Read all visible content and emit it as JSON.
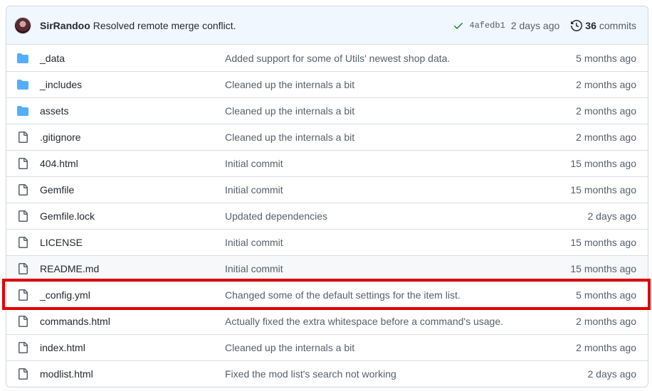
{
  "latest_commit": {
    "author": "SirRandoo",
    "message": "Resolved remote merge conflict.",
    "sha": "4afedb1",
    "age": "2 days ago",
    "commit_count": "36",
    "commit_label": "commits",
    "status_color": "#1a7f37"
  },
  "files": [
    {
      "type": "folder",
      "name": "_data",
      "message": "Added support for some of Utils' newest shop data.",
      "age": "5 months ago"
    },
    {
      "type": "folder",
      "name": "_includes",
      "message": "Cleaned up the internals a bit",
      "age": "2 months ago"
    },
    {
      "type": "folder",
      "name": "assets",
      "message": "Cleaned up the internals a bit",
      "age": "2 months ago"
    },
    {
      "type": "file",
      "name": ".gitignore",
      "message": "Cleaned up the internals a bit",
      "age": "2 months ago"
    },
    {
      "type": "file",
      "name": "404.html",
      "message": "Initial commit",
      "age": "15 months ago"
    },
    {
      "type": "file",
      "name": "Gemfile",
      "message": "Initial commit",
      "age": "15 months ago"
    },
    {
      "type": "file",
      "name": "Gemfile.lock",
      "message": "Updated dependencies",
      "age": "2 days ago"
    },
    {
      "type": "file",
      "name": "LICENSE",
      "message": "Initial commit",
      "age": "15 months ago"
    },
    {
      "type": "file",
      "name": "README.md",
      "message": "Initial commit",
      "age": "15 months ago"
    },
    {
      "type": "file",
      "name": "_config.yml",
      "message": "Changed some of the default settings for the item list.",
      "age": "5 months ago"
    },
    {
      "type": "file",
      "name": "commands.html",
      "message": "Actually fixed the extra whitespace before a command's usage.",
      "age": "2 months ago"
    },
    {
      "type": "file",
      "name": "index.html",
      "message": "Cleaned up the internals a bit",
      "age": "2 months ago"
    },
    {
      "type": "file",
      "name": "modlist.html",
      "message": "Fixed the mod list's search not working",
      "age": "2 days ago"
    }
  ],
  "colors": {
    "folder": "#54aeff",
    "file": "#57606a",
    "highlight": "#e00000"
  }
}
